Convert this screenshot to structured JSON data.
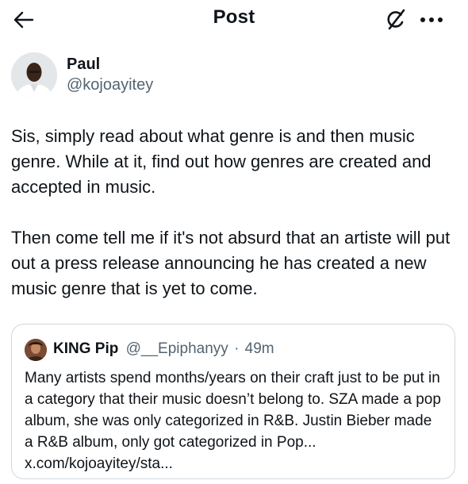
{
  "header": {
    "title": "Post",
    "icons": {
      "back": "arrow-left-icon",
      "grok": "grok-icon",
      "more": "more-horizontal-icon"
    }
  },
  "author": {
    "name": "Paul",
    "handle": "@kojoayitey"
  },
  "post": {
    "paragraphs": [
      "Sis, simply read about what genre is and then music genre. While at it, find out how genres are created and accepted in music.",
      "Then come tell me if it's not absurd that an artiste will put out a press release announcing he has created a new music genre that is yet to come."
    ]
  },
  "quoted_post": {
    "name": "KING Pip",
    "handle": "@__Epiphanyy",
    "separator": "·",
    "time": "49m",
    "text": "Many artists spend months/years on their craft just to be put in a category that their music doesn’t belong to. SZA made a pop album, she was only categorized in R&B. Justin Bieber made a R&B album, only got categorized in Pop... x.com/kojoayitey/sta..."
  },
  "colors": {
    "text_primary": "#0f1419",
    "text_secondary": "#536471",
    "border": "#cfd9de",
    "background": "#ffffff"
  }
}
